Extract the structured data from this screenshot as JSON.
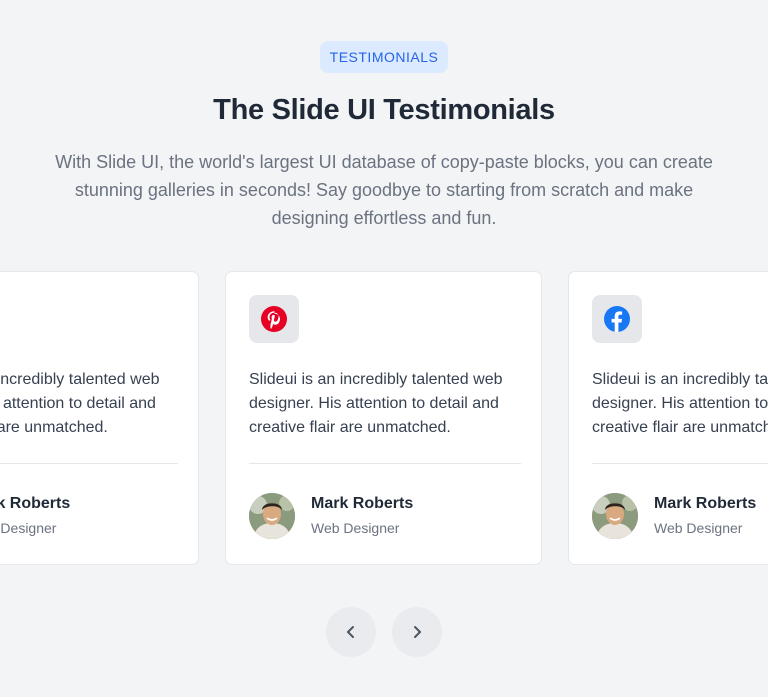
{
  "header": {
    "badge": "TESTIMONIALS",
    "title": "The Slide UI Testimonials",
    "subtitle": "With Slide UI, the world's largest UI database of copy-paste blocks, you can create stunning galleries in seconds! Say goodbye to starting from scratch and make designing effortless and fun."
  },
  "testimonials": [
    {
      "brand_icon": "blank",
      "quote": "Slideui is an incredibly talented web designer. His attention to detail and creative flair are unmatched.",
      "name": "Mark Roberts",
      "role": "Web Designer"
    },
    {
      "brand_icon": "pinterest-icon",
      "quote": "Slideui is an incredibly talented web designer. His attention to detail and creative flair are unmatched.",
      "name": "Mark Roberts",
      "role": "Web Designer"
    },
    {
      "brand_icon": "facebook-icon",
      "quote": "Slideui is an incredibly talented web designer. His attention to detail and creative flair are unmatched.",
      "name": "Mark Roberts",
      "role": "Web Designer"
    }
  ],
  "controls": {
    "prev_icon": "chevron-left-icon",
    "next_icon": "chevron-right-icon"
  },
  "colors": {
    "background": "#f3f4f6",
    "badge_bg": "#dbeafe",
    "badge_text": "#2563eb",
    "pinterest": "#e60023",
    "facebook": "#1877f2"
  }
}
